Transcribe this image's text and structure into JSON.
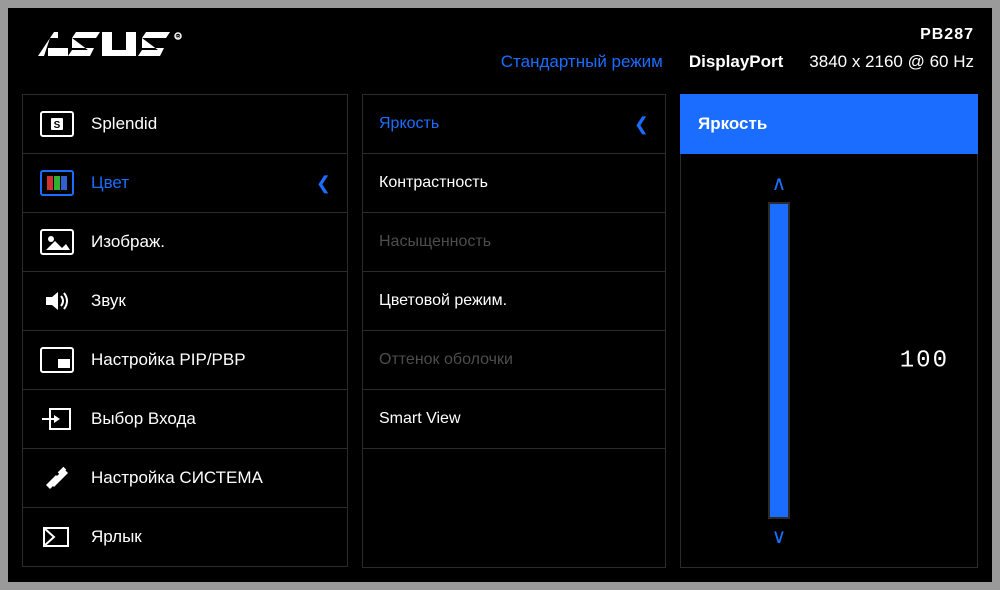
{
  "header": {
    "brand": "ASUS",
    "model": "PB287",
    "mode": "Стандартный режим",
    "input": "DisplayPort",
    "resolution": "3840 x 2160 @ 60 Hz"
  },
  "menu": {
    "items": [
      {
        "id": "splendid",
        "label": "Splendid"
      },
      {
        "id": "color",
        "label": "Цвет"
      },
      {
        "id": "image",
        "label": "Изображ."
      },
      {
        "id": "sound",
        "label": "Звук"
      },
      {
        "id": "pip",
        "label": "Настройка PIP/PBP"
      },
      {
        "id": "input",
        "label": "Выбор Входа"
      },
      {
        "id": "system",
        "label": "Настройка СИСТЕМА"
      },
      {
        "id": "shortcut",
        "label": "Ярлык"
      }
    ],
    "selected_index": 1
  },
  "submenu": {
    "items": [
      {
        "label": "Яркость",
        "disabled": false
      },
      {
        "label": "Контрастность",
        "disabled": false
      },
      {
        "label": "Насыщенность",
        "disabled": true
      },
      {
        "label": "Цветoвой режим.",
        "disabled": false
      },
      {
        "label": "Оттенок оболочки",
        "disabled": true
      },
      {
        "label": "Smart View",
        "disabled": false
      }
    ],
    "selected_index": 0
  },
  "slider": {
    "title": "Яркость",
    "value": 100,
    "min": 0,
    "max": 100
  }
}
